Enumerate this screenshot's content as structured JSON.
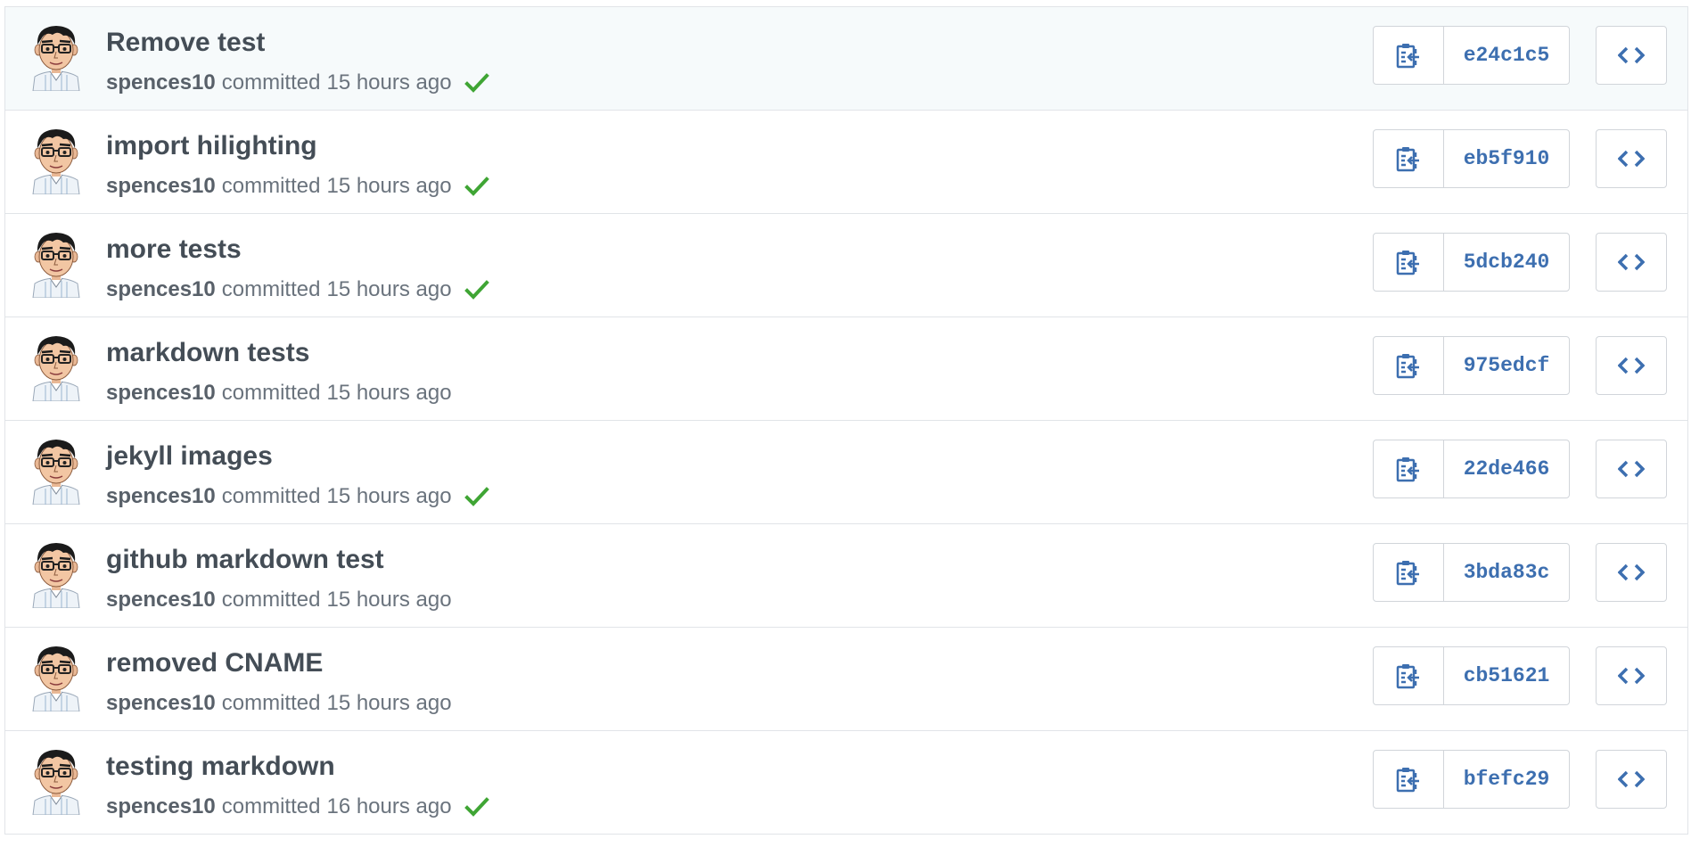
{
  "colors": {
    "link": "#3d6fb0",
    "check": "#3fa534",
    "title": "#444d56",
    "meta": "#6a737d",
    "border": "#d1d5da"
  },
  "icons": {
    "copy": "clippy-icon",
    "browse": "code-icon",
    "status": "check-icon",
    "avatar": "avatar-cartoon"
  },
  "commits": [
    {
      "title": "Remove test",
      "author": "spences10",
      "verb": "committed",
      "time": "15 hours ago",
      "verified": true,
      "sha": "e24c1c5"
    },
    {
      "title": "import hilighting",
      "author": "spences10",
      "verb": "committed",
      "time": "15 hours ago",
      "verified": true,
      "sha": "eb5f910"
    },
    {
      "title": "more tests",
      "author": "spences10",
      "verb": "committed",
      "time": "15 hours ago",
      "verified": true,
      "sha": "5dcb240"
    },
    {
      "title": "markdown tests",
      "author": "spences10",
      "verb": "committed",
      "time": "15 hours ago",
      "verified": false,
      "sha": "975edcf"
    },
    {
      "title": "jekyll images",
      "author": "spences10",
      "verb": "committed",
      "time": "15 hours ago",
      "verified": true,
      "sha": "22de466"
    },
    {
      "title": "github markdown test",
      "author": "spences10",
      "verb": "committed",
      "time": "15 hours ago",
      "verified": false,
      "sha": "3bda83c"
    },
    {
      "title": "removed CNAME",
      "author": "spences10",
      "verb": "committed",
      "time": "15 hours ago",
      "verified": false,
      "sha": "cb51621"
    },
    {
      "title": "testing markdown",
      "author": "spences10",
      "verb": "committed",
      "time": "16 hours ago",
      "verified": true,
      "sha": "bfefc29"
    }
  ]
}
